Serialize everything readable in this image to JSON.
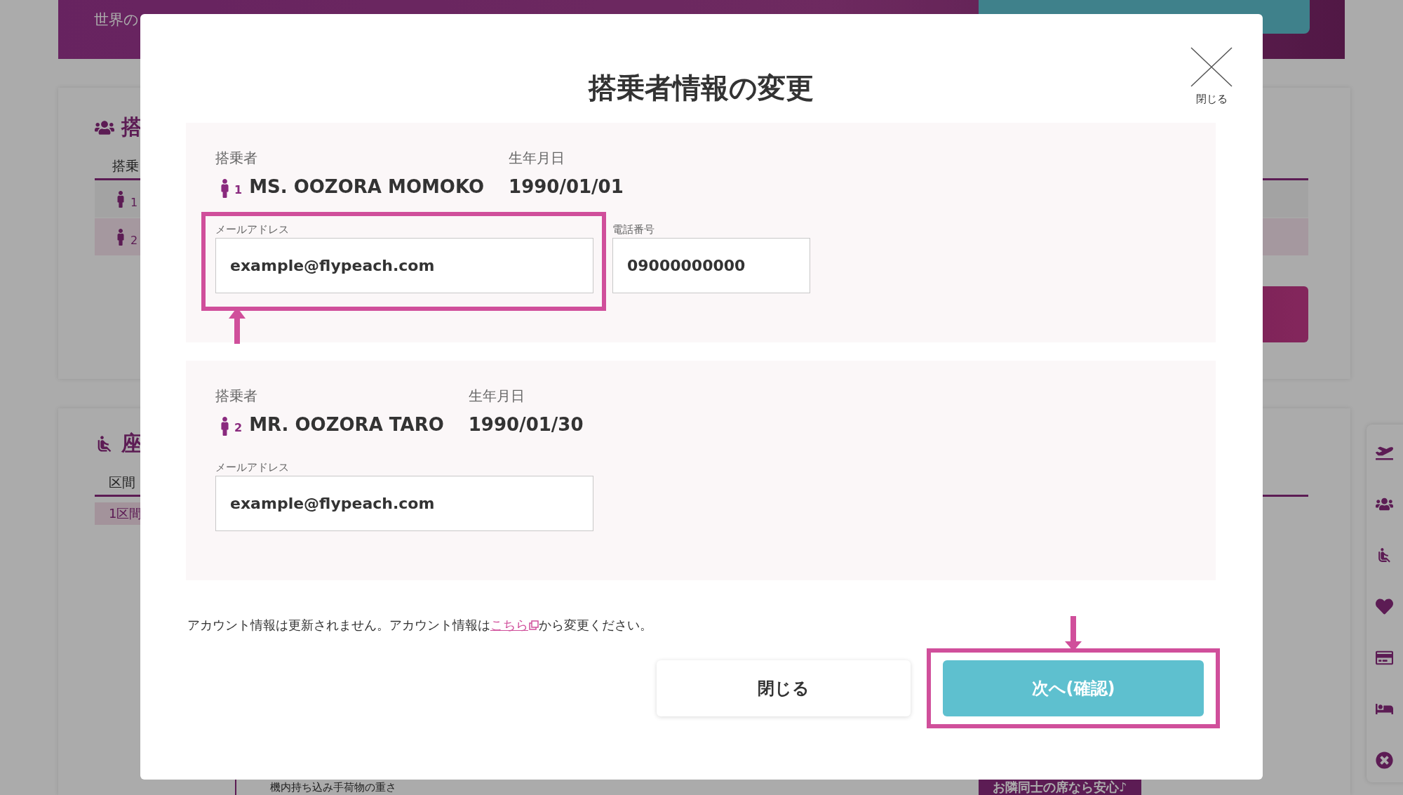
{
  "background": {
    "header_subtitle": "世界の",
    "passenger_section": {
      "title": "搭",
      "column": "搭乗",
      "rows": [
        {
          "number": "1",
          "selected": false
        },
        {
          "number": "2",
          "selected": true
        }
      ]
    },
    "seat_section": {
      "title": "座",
      "column": "区間",
      "cell": "1区間"
    },
    "baggage_label": "機内持ち込み手荷物の重さ",
    "promo_banner": "お隣同士の席なら安心♪"
  },
  "modal": {
    "title": "搭乗者情報の変更",
    "close_label": "閉じる",
    "passengers": [
      {
        "passenger_label": "搭乗者",
        "number": "1",
        "name": "MS. OOZORA MOMOKO",
        "birth_label": "生年月日",
        "birth_date": "1990/01/01",
        "fields": [
          {
            "label": "メールアドレス",
            "value": "example@flypeach.com",
            "highlighted": true
          },
          {
            "label": "電話番号",
            "value": "09000000000",
            "highlighted": false
          }
        ]
      },
      {
        "passenger_label": "搭乗者",
        "number": "2",
        "name": "MR. OOZORA TARO",
        "birth_label": "生年月日",
        "birth_date": "1990/01/30",
        "fields": [
          {
            "label": "メールアドレス",
            "value": "example@flypeach.com",
            "highlighted": false
          }
        ]
      }
    ],
    "note": {
      "before": "アカウント情報は更新されません。アカウント情報は",
      "link": "こちら",
      "after": "から変更ください。"
    },
    "buttons": [
      {
        "label": "閉じる",
        "kind": "secondary",
        "highlighted": false
      },
      {
        "label": "次へ(確認)",
        "kind": "primary",
        "highlighted": true
      }
    ]
  }
}
